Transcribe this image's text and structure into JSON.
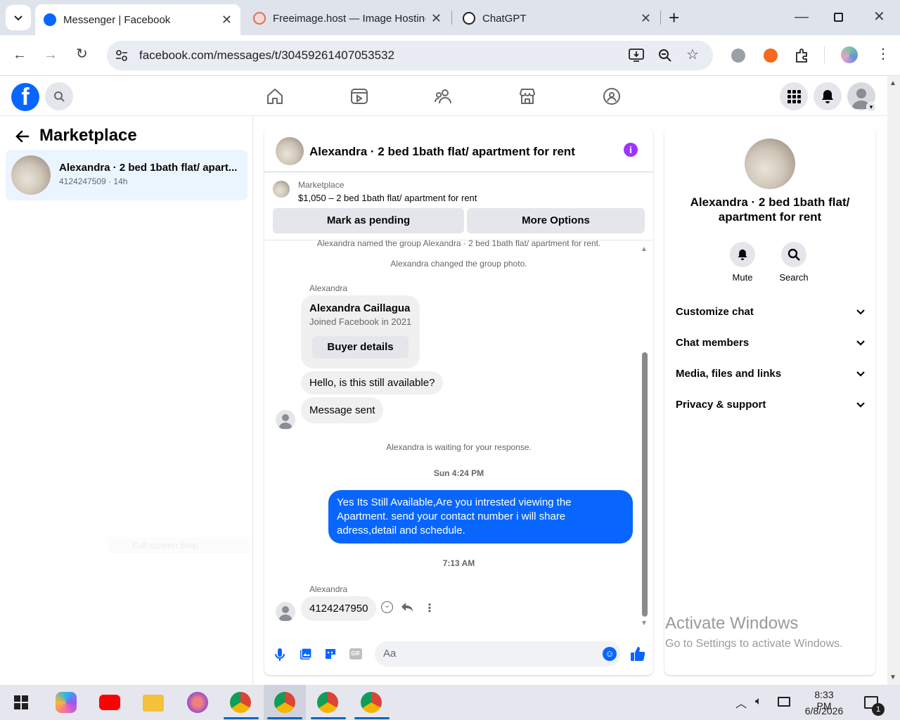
{
  "browser": {
    "tabs": [
      {
        "title": "Messenger | Facebook"
      },
      {
        "title": "Freeimage.host — Image Hosting"
      },
      {
        "title": "ChatGPT"
      }
    ],
    "new_tab": "+",
    "url": "facebook.com/messages/t/30459261407053532"
  },
  "left": {
    "title": "Marketplace",
    "conversation": {
      "name": "Alexandra · 2 bed 1bath flat/ apart...",
      "meta": "4124247509 · 14h"
    },
    "ghost": "Full-screen Snip"
  },
  "chat": {
    "header_title": "Alexandra · 2 bed 1bath flat/ apartment for rent",
    "listing": {
      "source": "Marketplace",
      "summary": "$1,050 – 2 bed 1bath flat/ apartment for rent"
    },
    "buttons": {
      "pending": "Mark as pending",
      "more": "More Options"
    },
    "messages": {
      "sys1": "Alexandra named the group Alexandra · 2 bed 1bath flat/ apartment for rent.",
      "sys2": "Alexandra changed the group photo.",
      "sender1": "Alexandra",
      "card_name": "Alexandra Caillagua",
      "card_sub": "Joined Facebook in 2021",
      "card_button": "Buyer details",
      "msg1": "Hello, is this still available?",
      "msg2": "Message sent",
      "sys3": "Alexandra is waiting for your response.",
      "time1": "Sun 4:24 PM",
      "outgoing": "Yes Its Still Available,Are you intrested viewing the Apartment. send your contact number i will share adress,detail and schedule.",
      "time2": "7:13 AM",
      "sender2": "Alexandra",
      "msg3": "4124247950"
    },
    "composer_placeholder": "Aa",
    "gif_label": "GIF"
  },
  "info": {
    "title": "Alexandra · 2 bed 1bath flat/ apartment for rent",
    "mute": "Mute",
    "search": "Search",
    "sections": [
      {
        "label": "Customize chat"
      },
      {
        "label": "Chat members"
      },
      {
        "label": "Media, files and links"
      },
      {
        "label": "Privacy & support"
      }
    ]
  },
  "watermark": {
    "title": "Activate Windows",
    "sub": "Go to Settings to activate Windows."
  },
  "taskbar": {
    "time": "8:33 PM",
    "date": "6/8/2026",
    "notif_count": "1"
  },
  "colors": {
    "brand": "#0866ff",
    "info_purple": "#a033ff"
  }
}
